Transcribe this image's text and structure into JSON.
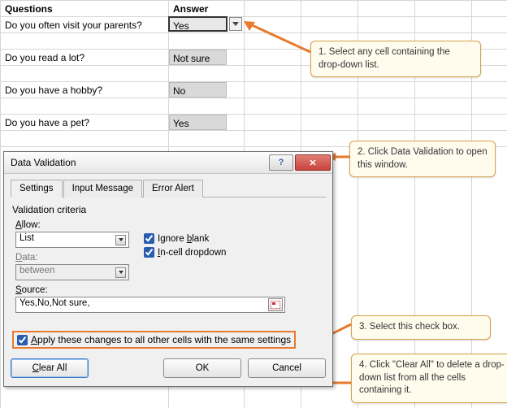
{
  "sheet": {
    "header_questions": "Questions",
    "header_answer": "Answer",
    "rows": [
      {
        "q": "Do you often visit your parents?",
        "a": "Yes"
      },
      {
        "q": "Do you read a lot?",
        "a": "Not sure"
      },
      {
        "q": "Do you have a hobby?",
        "a": "No"
      },
      {
        "q": "Do you have a pet?",
        "a": "Yes"
      }
    ]
  },
  "callouts": {
    "c1": "1. Select any cell containing the drop-down list.",
    "c2": "2. Click Data Validation to open this window.",
    "c3": "3. Select this check box.",
    "c4": "4. Click \"Clear All\" to delete a drop-down list from all the cells containing it."
  },
  "dialog": {
    "title": "Data Validation",
    "tabs": {
      "settings": "Settings",
      "input_message": "Input Message",
      "error_alert": "Error Alert"
    },
    "criteria_label": "Validation criteria",
    "allow_label": "Allow:",
    "allow_value": "List",
    "data_label": "Data:",
    "data_value": "between",
    "ignore_blank": "Ignore blank",
    "incell_dropdown": "In-cell dropdown",
    "source_label": "Source:",
    "source_value": "Yes,No,Not sure,",
    "apply_label": "Apply these changes to all other cells with the same settings",
    "clear_all": "Clear All",
    "ok": "OK",
    "cancel": "Cancel"
  },
  "colors": {
    "callout_bg": "#fffcee",
    "callout_border": "#d7a24a",
    "arrow": "#e77a2f"
  }
}
